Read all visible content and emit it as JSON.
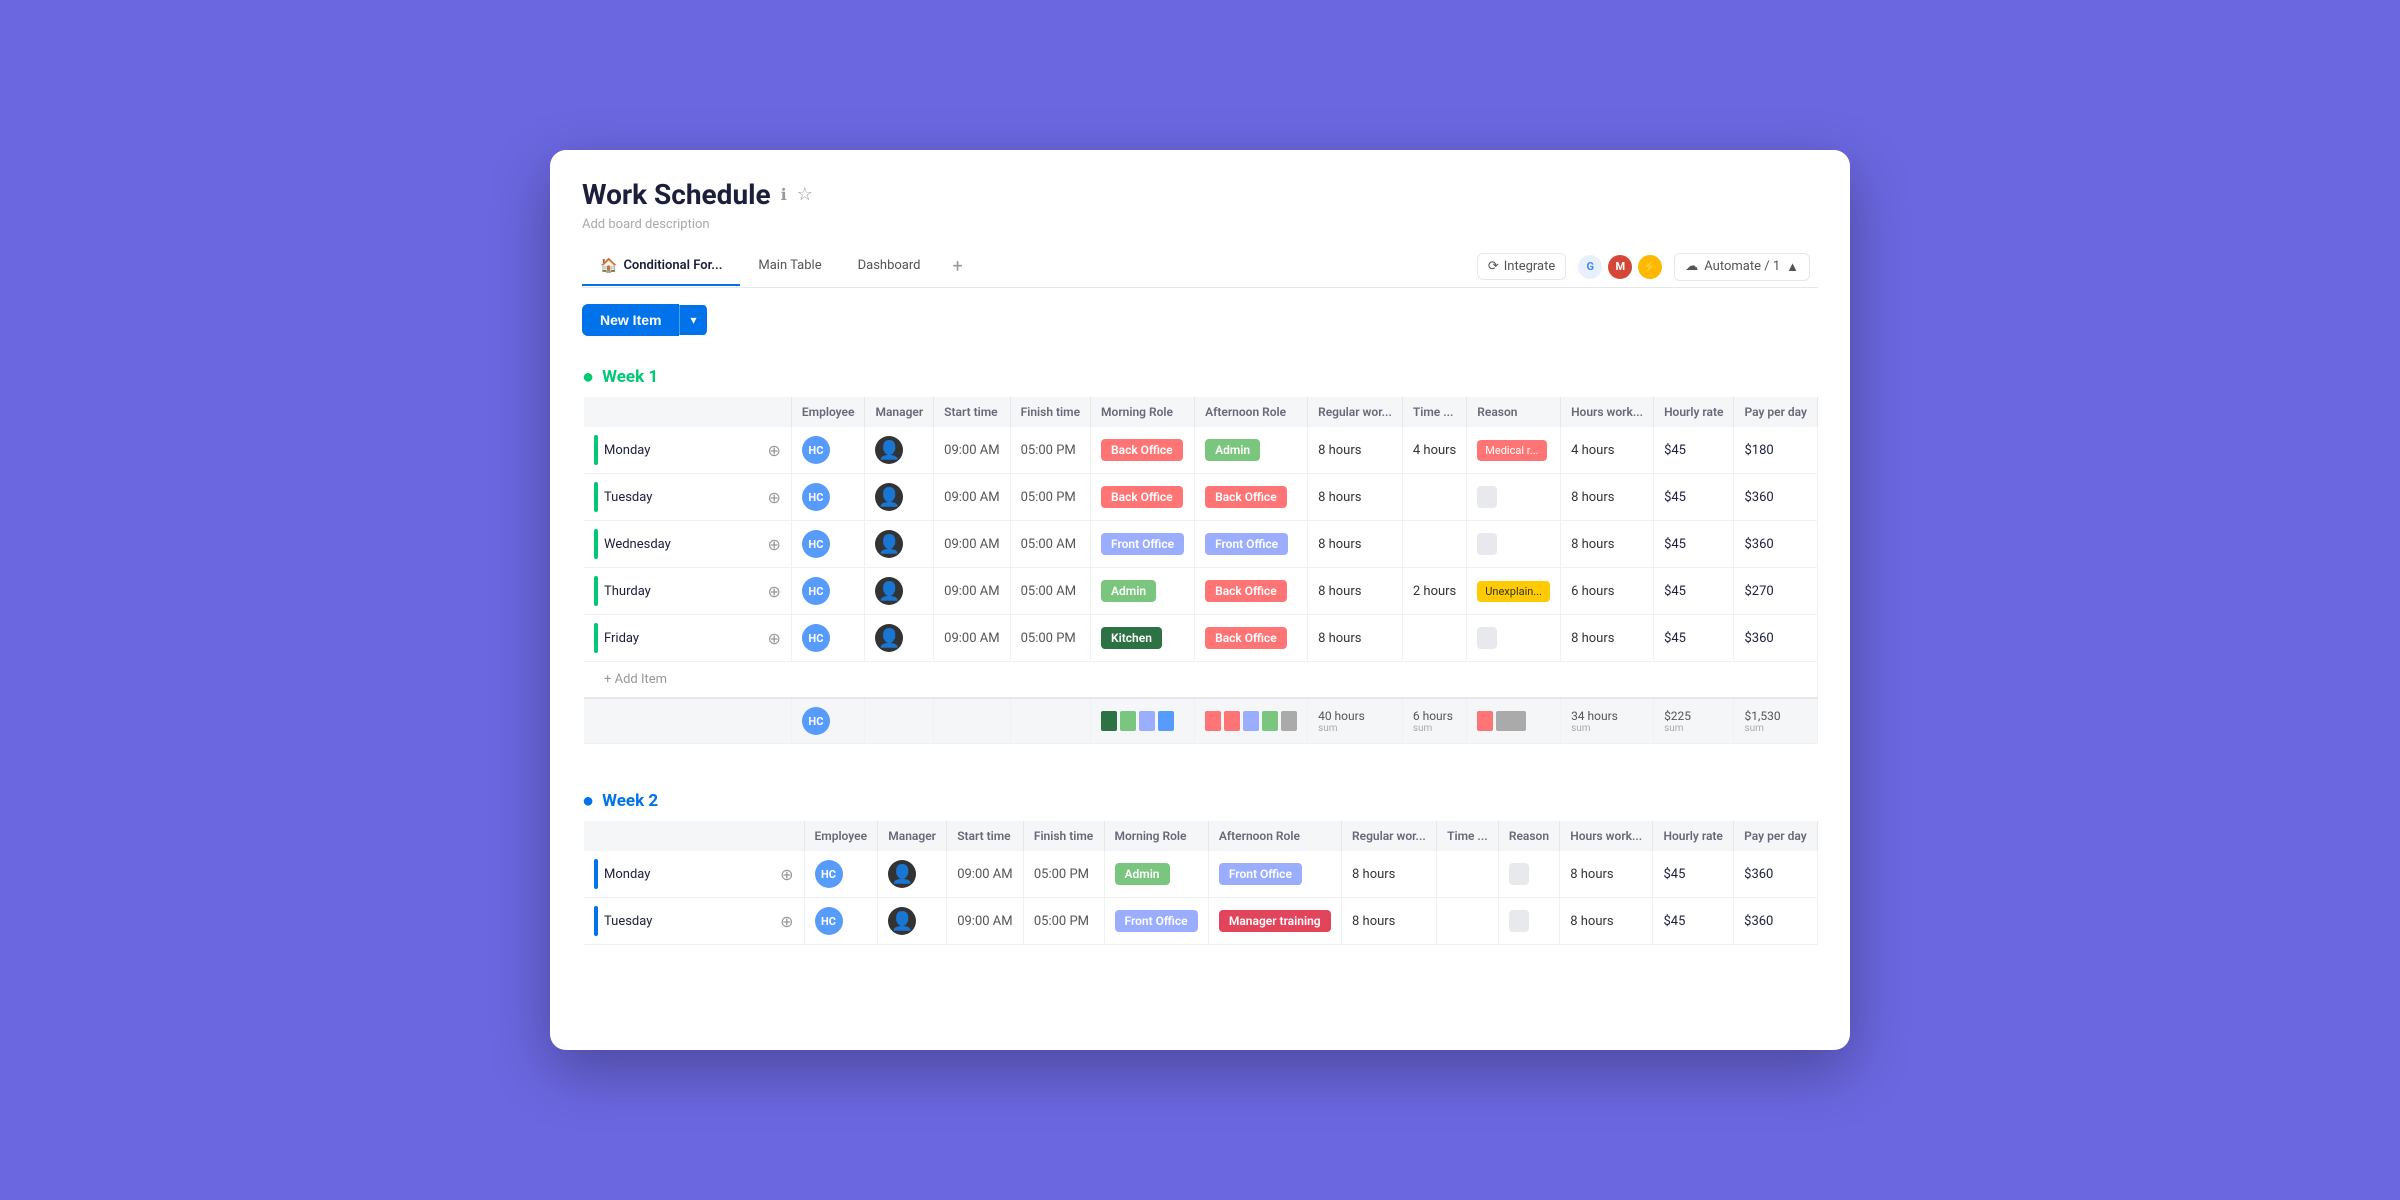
{
  "window": {
    "title": "Work Schedule",
    "description": "Add board description",
    "info_icon": "ℹ",
    "star_icon": "☆"
  },
  "tabs": [
    {
      "id": "conditional",
      "label": "Conditional For...",
      "icon": "🏠",
      "active": true
    },
    {
      "id": "main-table",
      "label": "Main Table",
      "icon": "",
      "active": false
    },
    {
      "id": "dashboard",
      "label": "Dashboard",
      "icon": "",
      "active": false
    }
  ],
  "toolbar": {
    "new_item_label": "New Item",
    "new_item_arrow": "▾"
  },
  "integrate": {
    "label": "Integrate",
    "icon": "⟳"
  },
  "automate": {
    "label": "Automate / 1",
    "icon": "⚙"
  },
  "columns": [
    "Employee",
    "Manager",
    "Start time",
    "Finish time",
    "Morning Role",
    "Afternoon Role",
    "Regular wor...",
    "Time ...",
    "Reason",
    "Hours work...",
    "Hourly rate",
    "Pay per day"
  ],
  "week1": {
    "title": "Week 1",
    "color": "green",
    "rows": [
      {
        "day": "Monday",
        "bar_color": "#00c875",
        "employee": "HC",
        "start": "09:00 AM",
        "finish": "05:00 PM",
        "morning_role": "Back Office",
        "morning_class": "role-back-office",
        "afternoon_role": "Admin",
        "afternoon_class": "role-admin",
        "regular_hours": "8 hours",
        "time_off": "4 hours",
        "reason": "Medical r...",
        "reason_class": "reason-badge",
        "hours_worked": "4 hours",
        "hourly_rate": "$45",
        "pay_per_day": "$180"
      },
      {
        "day": "Tuesday",
        "bar_color": "#00c875",
        "employee": "HC",
        "start": "09:00 AM",
        "finish": "05:00 PM",
        "morning_role": "Back Office",
        "morning_class": "role-back-office",
        "afternoon_role": "Back Office",
        "afternoon_class": "role-back-office",
        "regular_hours": "8 hours",
        "time_off": "",
        "reason": "",
        "reason_class": "",
        "hours_worked": "8 hours",
        "hourly_rate": "$45",
        "pay_per_day": "$360"
      },
      {
        "day": "Wednesday",
        "bar_color": "#00c875",
        "employee": "HC",
        "start": "09:00 AM",
        "finish": "05:00 AM",
        "morning_role": "Front Office",
        "morning_class": "role-front-office",
        "afternoon_role": "Front Office",
        "afternoon_class": "role-front-office",
        "regular_hours": "8 hours",
        "time_off": "",
        "reason": "",
        "reason_class": "",
        "hours_worked": "8 hours",
        "hourly_rate": "$45",
        "pay_per_day": "$360"
      },
      {
        "day": "Thurday",
        "bar_color": "#00c875",
        "employee": "HC",
        "start": "09:00 AM",
        "finish": "05:00 AM",
        "morning_role": "Admin",
        "morning_class": "role-admin",
        "afternoon_role": "Back Office",
        "afternoon_class": "role-back-office",
        "regular_hours": "8 hours",
        "time_off": "2 hours",
        "reason": "Unexplain...",
        "reason_class": "reason-badge reason-unexplained",
        "hours_worked": "6 hours",
        "hourly_rate": "$45",
        "pay_per_day": "$270"
      },
      {
        "day": "Friday",
        "bar_color": "#00c875",
        "employee": "HC",
        "start": "09:00 AM",
        "finish": "05:00 PM",
        "morning_role": "Kitchen",
        "morning_class": "role-kitchen",
        "afternoon_role": "Back Office",
        "afternoon_class": "role-back-office",
        "regular_hours": "8 hours",
        "time_off": "",
        "reason": "",
        "reason_class": "",
        "hours_worked": "8 hours",
        "hourly_rate": "$45",
        "pay_per_day": "$360"
      }
    ],
    "summary": {
      "regular_hours": "40 hours",
      "time_off": "6 hours",
      "hours_worked": "34 hours",
      "hourly_rate": "$225",
      "pay_per_day": "$1,530",
      "sum_label": "sum"
    },
    "add_item": "+ Add Item"
  },
  "week2": {
    "title": "Week 2",
    "color": "blue",
    "rows": [
      {
        "day": "Monday",
        "bar_color": "#0073ea",
        "employee": "HC",
        "start": "09:00 AM",
        "finish": "05:00 PM",
        "morning_role": "Admin",
        "morning_class": "role-admin",
        "afternoon_role": "Front Office",
        "afternoon_class": "role-front-office",
        "regular_hours": "8 hours",
        "time_off": "",
        "reason": "",
        "reason_class": "",
        "hours_worked": "8 hours",
        "hourly_rate": "$45",
        "pay_per_day": "$360"
      },
      {
        "day": "Tuesday",
        "bar_color": "#0073ea",
        "employee": "HC",
        "start": "09:00 AM",
        "finish": "05:00 PM",
        "morning_role": "Front Office",
        "morning_class": "role-front-office",
        "afternoon_role": "Manager training",
        "afternoon_class": "role-manager-training",
        "regular_hours": "8 hours",
        "time_off": "",
        "reason": "",
        "reason_class": "",
        "hours_worked": "8 hours",
        "hourly_rate": "$45",
        "pay_per_day": "$360"
      }
    ]
  }
}
